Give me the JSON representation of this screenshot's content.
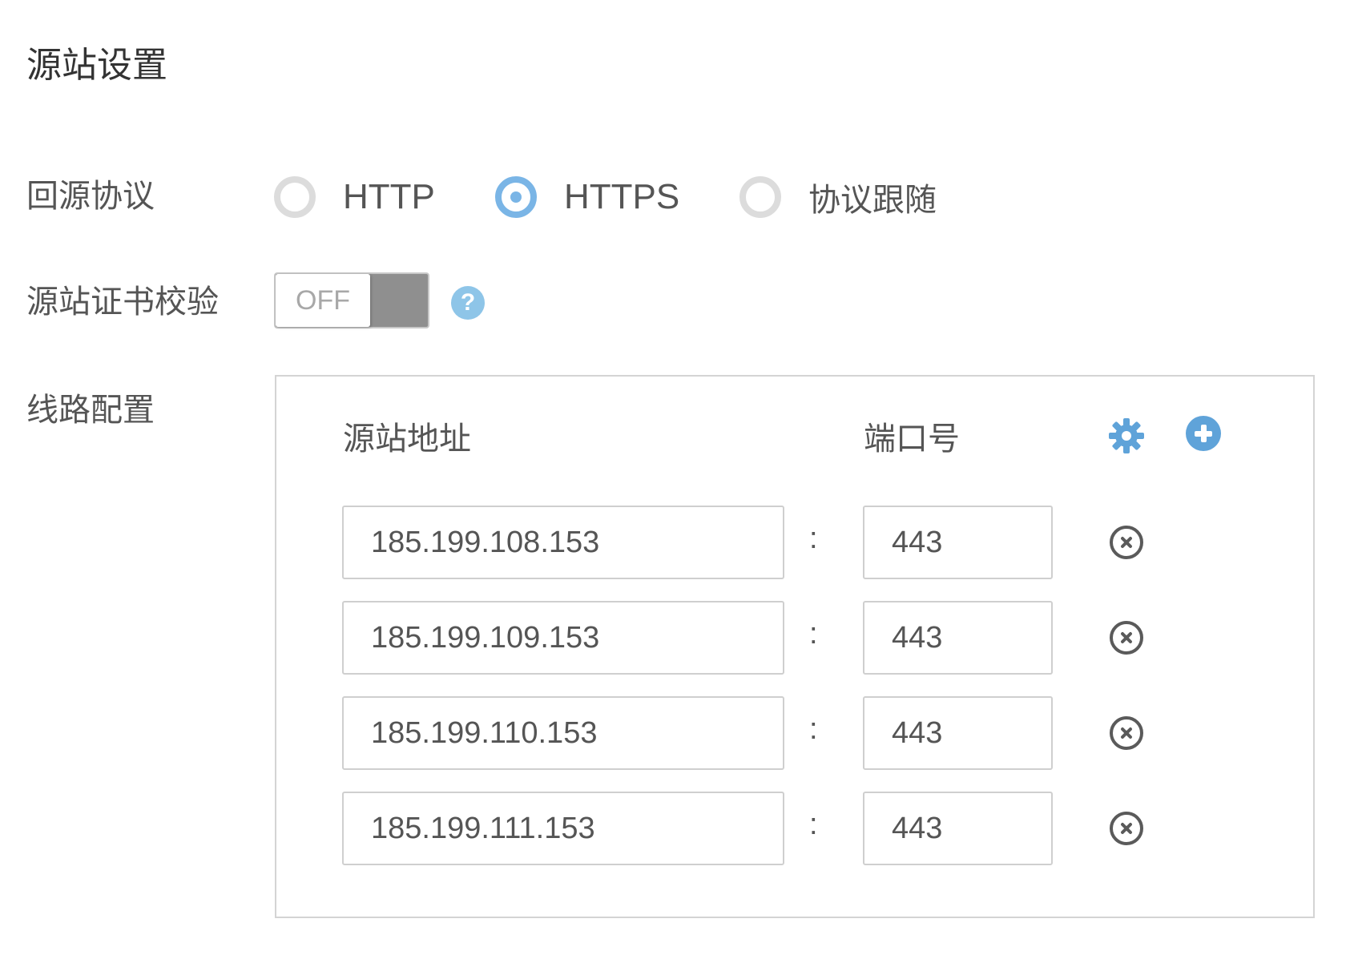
{
  "page": {
    "title": "源站设置"
  },
  "protocol": {
    "label": "回源协议",
    "options": [
      {
        "label": "HTTP",
        "checked": false
      },
      {
        "label": "HTTPS",
        "checked": true
      },
      {
        "label": "协议跟随",
        "checked": false
      }
    ]
  },
  "cert_check": {
    "label": "源站证书校验",
    "toggle_text": "OFF",
    "enabled": false,
    "help_icon": "question-circle-icon",
    "help_glyph": "?"
  },
  "lines": {
    "label": "线路配置",
    "address_header": "源站地址",
    "port_header": "端口号",
    "settings_icon": "gear-icon",
    "add_icon": "plus-circle-icon",
    "separator": ":",
    "rows": [
      {
        "address": "185.199.108.153",
        "port": "443"
      },
      {
        "address": "185.199.109.153",
        "port": "443"
      },
      {
        "address": "185.199.110.153",
        "port": "443"
      },
      {
        "address": "185.199.111.153",
        "port": "443"
      }
    ]
  },
  "colors": {
    "accent": "#7ab5e6",
    "add_icon": "#5fa3d9",
    "help_icon": "#8ec5e8",
    "toggle_off_track": "#8f8f8f"
  }
}
